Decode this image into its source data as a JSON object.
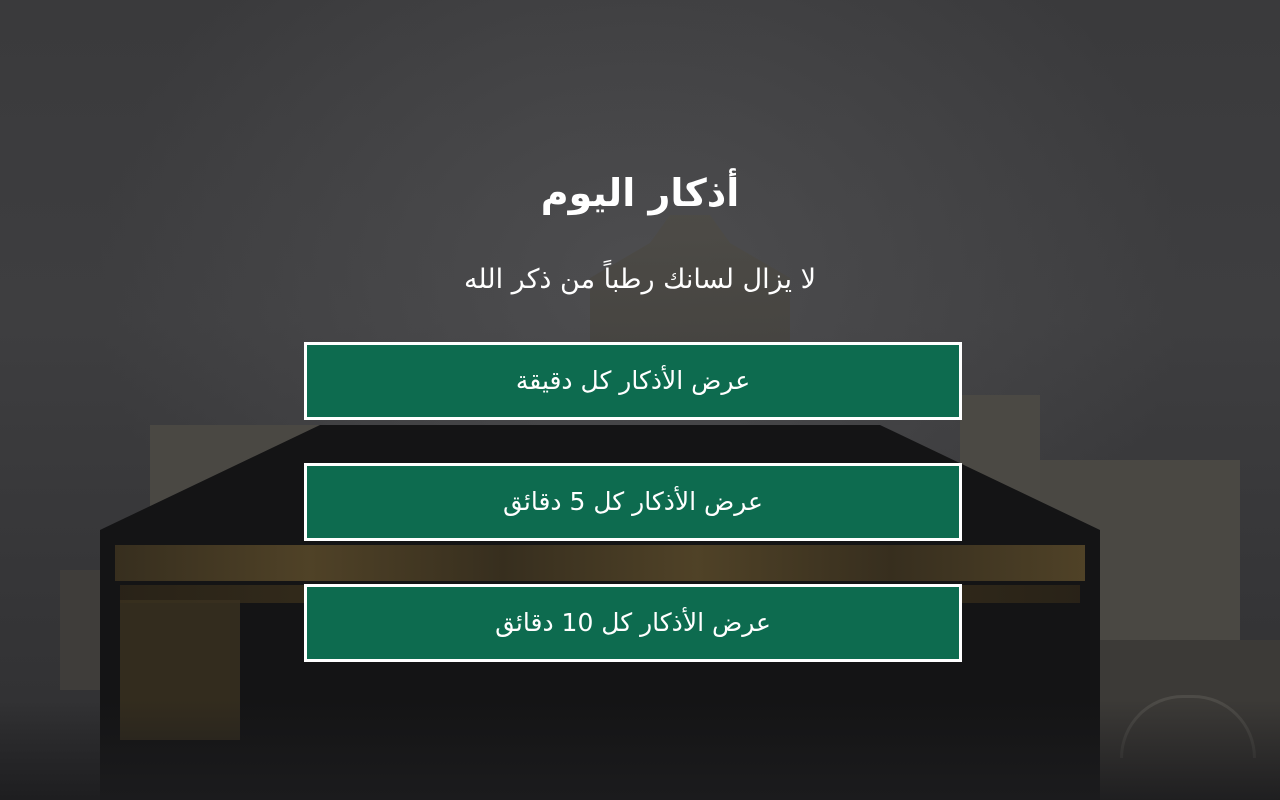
{
  "page": {
    "title": "أذكار اليوم",
    "subtitle": "لا يزال لسانك رطباً من ذكر الله"
  },
  "buttons": [
    {
      "label": "عرض الأذكار كل دقيقة"
    },
    {
      "label": "عرض الأذكار كل 5 دقائق"
    },
    {
      "label": "عرض الأذكار كل 10 دقائق"
    }
  ],
  "colors": {
    "button_bg": "#0d6b4f",
    "button_border": "#ffffff",
    "text": "#ffffff",
    "overlay": "#3a3a3c"
  }
}
